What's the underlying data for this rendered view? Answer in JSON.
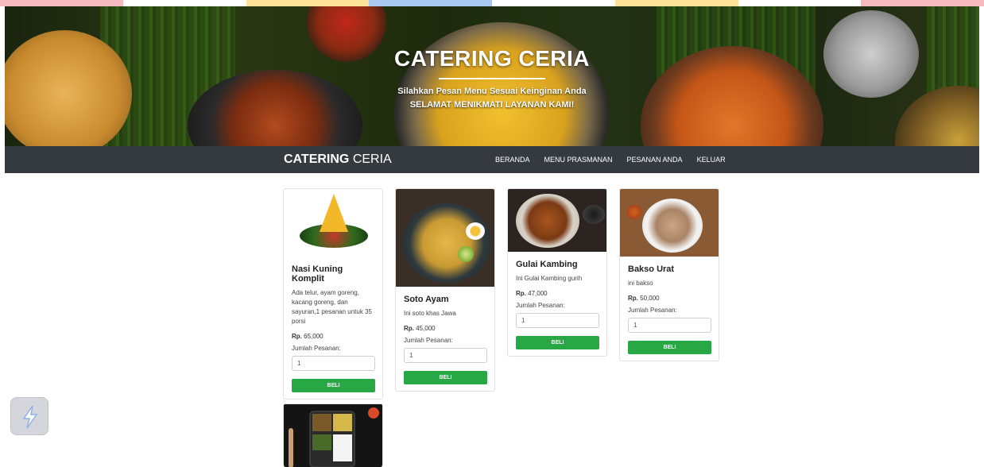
{
  "hero": {
    "title": "CATERING CERIA",
    "subtitle_line1": "Silahkan Pesan Menu Sesuai Keinginan Anda",
    "subtitle_line2": "SELAMAT MENIKMATI LAYANAN KAMI!"
  },
  "navbar": {
    "brand_bold": "CATERING",
    "brand_rest": "CERIA",
    "links": [
      "BERANDA",
      "MENU PRASMANAN",
      "PESANAN ANDA",
      "KELUAR"
    ]
  },
  "menu": {
    "qty_label": "Jumlah Pesanan:",
    "buy_label": "BELI",
    "price_prefix": "Rp.",
    "items": [
      {
        "name": "Nasi Kuning Komplit",
        "description": "Ada telur, ayam goreng, kacang goreng, dan sayuran,1 pesanan untuk 35 porsi",
        "price": "65,000",
        "quantity": "1"
      },
      {
        "name": "Soto Ayam",
        "description": "Ini soto khas Jawa",
        "price": "45,000",
        "quantity": "1"
      },
      {
        "name": "Gulai Kambing",
        "description": "Ini Gulai Kambing gurih",
        "price": "47,000",
        "quantity": "1"
      },
      {
        "name": "Bakso Urat",
        "description": "ini bakso",
        "price": "50,000",
        "quantity": "1"
      }
    ]
  },
  "colors": {
    "navbar": "#343a40",
    "buy_button": "#28a745"
  },
  "icons": {
    "floating_logo": "lightning-logo-icon"
  }
}
